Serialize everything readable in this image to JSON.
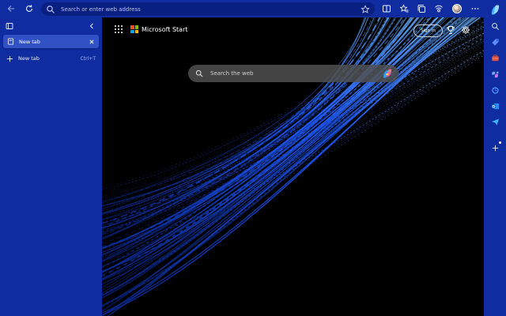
{
  "toolbar": {
    "address_placeholder": "Search or enter web address"
  },
  "sidebar_tabs": {
    "active_tab_label": "New tab",
    "new_tab_label": "New tab",
    "new_tab_shortcut": "Ctrl+T"
  },
  "ntp": {
    "brand_title": "Microsoft Start",
    "signin_label": "Sign in",
    "search_placeholder": "Search the web"
  },
  "colors": {
    "chrome": "#0f2da1",
    "active_tab": "#3152c4",
    "page_bg": "#000000",
    "accent_blue": "#1e5bff"
  },
  "icons": {
    "toolbar": [
      "back-icon",
      "refresh-icon",
      "search-icon",
      "favorite-star-icon",
      "split-screen-icon",
      "favorites-icon",
      "collections-icon",
      "browser-essentials-icon",
      "profile-avatar",
      "more-icon"
    ],
    "right_sidebar": [
      "copilot-icon",
      "search-icon",
      "shopping-tag-icon",
      "tools-briefcase-icon",
      "games-icon",
      "drop-icon",
      "outlook-icon",
      "send-icon",
      "add-icon"
    ]
  }
}
